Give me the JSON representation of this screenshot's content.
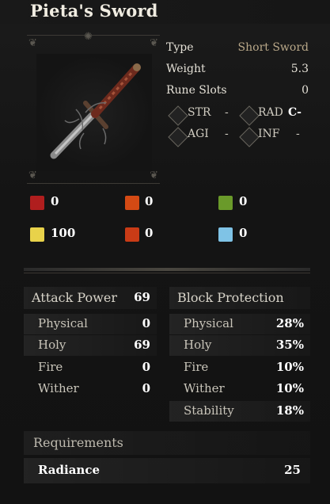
{
  "item": {
    "name": "Pieta's Sword",
    "icon": "sword-icon"
  },
  "info": {
    "type_label": "Type",
    "type_value": "Short Sword",
    "weight_label": "Weight",
    "weight_value": "5.3",
    "rune_slots_label": "Rune Slots",
    "rune_slots_value": "0"
  },
  "scaling": {
    "str": {
      "label": "STR",
      "value": "-",
      "icon": "strength-icon"
    },
    "rad": {
      "label": "RAD",
      "value": "C-",
      "icon": "radiance-icon"
    },
    "agi": {
      "label": "AGI",
      "value": "-",
      "icon": "agility-icon"
    },
    "inf": {
      "label": "INF",
      "value": "-",
      "icon": "inferno-icon"
    }
  },
  "resistances": [
    {
      "icon": "blood-icon",
      "value": "0",
      "color": "#b01e1e"
    },
    {
      "icon": "fire-icon",
      "value": "0",
      "color": "#d44a14"
    },
    {
      "icon": "poison-icon",
      "value": "0",
      "color": "#6a9a2a"
    },
    {
      "icon": "holy-icon",
      "value": "100",
      "color": "#e8d24a"
    },
    {
      "icon": "inferno-icon",
      "value": "0",
      "color": "#c93b16"
    },
    {
      "icon": "frost-icon",
      "value": "0",
      "color": "#7fc3e6"
    }
  ],
  "attack": {
    "header_label": "Attack Power",
    "header_value": "69",
    "rows": [
      {
        "label": "Physical",
        "value": "0"
      },
      {
        "label": "Holy",
        "value": "69"
      },
      {
        "label": "Fire",
        "value": "0"
      },
      {
        "label": "Wither",
        "value": "0"
      }
    ]
  },
  "block": {
    "header_label": "Block Protection",
    "rows": [
      {
        "label": "Physical",
        "value": "28%"
      },
      {
        "label": "Holy",
        "value": "35%"
      },
      {
        "label": "Fire",
        "value": "10%"
      },
      {
        "label": "Wither",
        "value": "10%"
      },
      {
        "label": "Stability",
        "value": "18%"
      }
    ]
  },
  "requirements": {
    "header_label": "Requirements",
    "row_label": "Radiance",
    "row_value": "25"
  }
}
